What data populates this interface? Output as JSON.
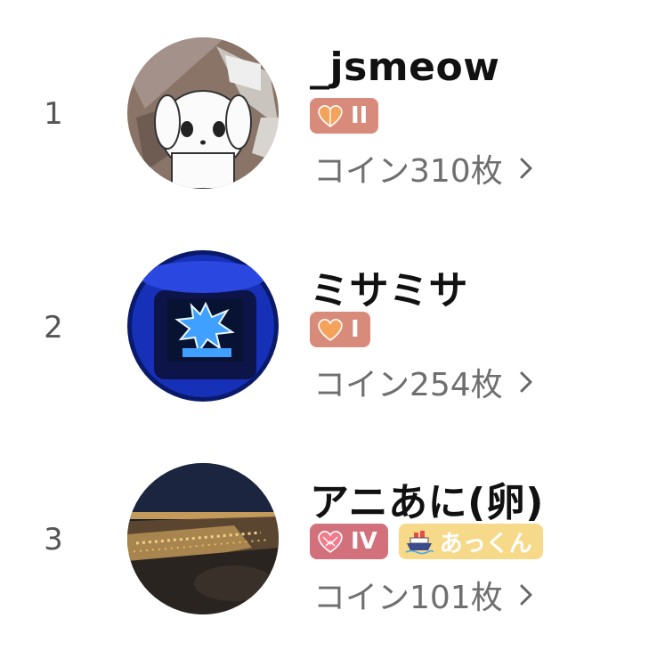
{
  "ranking": [
    {
      "rank": "1",
      "username": "_jsmeow",
      "badges": [
        {
          "type": "level",
          "icon": "orange-heart-icon",
          "text": "II",
          "color": "#d98b7b"
        }
      ],
      "coins": "コイン310枚"
    },
    {
      "rank": "2",
      "username": "ミサミサ",
      "badges": [
        {
          "type": "level",
          "icon": "orange-heart-icon",
          "text": "I",
          "color": "#d98b7b"
        }
      ],
      "coins": "コイン254枚"
    },
    {
      "rank": "3",
      "username": "アニあに(卵)",
      "badges": [
        {
          "type": "level",
          "icon": "pink-heart-icon",
          "text": "IV",
          "color": "#d2707c"
        },
        {
          "type": "fan",
          "icon": "ship-icon",
          "text": "あっくん",
          "color": "#f7d98a"
        }
      ],
      "coins": "コイン101枚"
    }
  ],
  "icons": {
    "chevron": "chevron-right-icon"
  }
}
